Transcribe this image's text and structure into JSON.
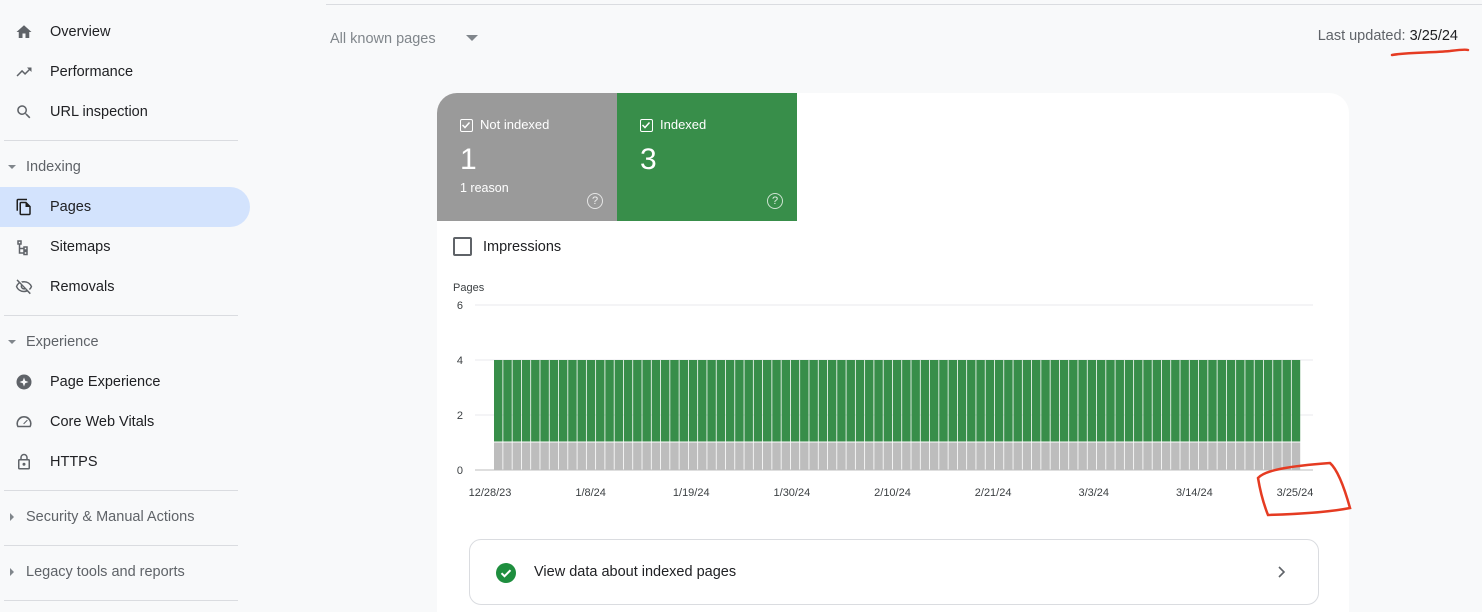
{
  "sidebar": {
    "items": [
      {
        "label": "Overview",
        "icon": "home-icon"
      },
      {
        "label": "Performance",
        "icon": "trending-up-icon"
      },
      {
        "label": "URL inspection",
        "icon": "search-icon"
      }
    ],
    "indexing": {
      "label": "Indexing",
      "items": [
        {
          "label": "Pages",
          "icon": "pages-icon",
          "active": true
        },
        {
          "label": "Sitemaps",
          "icon": "sitemap-icon"
        },
        {
          "label": "Removals",
          "icon": "eye-off-icon"
        }
      ]
    },
    "experience": {
      "label": "Experience",
      "items": [
        {
          "label": "Page Experience",
          "icon": "page-experience-icon"
        },
        {
          "label": "Core Web Vitals",
          "icon": "speedometer-icon"
        },
        {
          "label": "HTTPS",
          "icon": "lock-icon"
        }
      ]
    },
    "security": {
      "label": "Security & Manual Actions"
    },
    "legacy": {
      "label": "Legacy tools and reports"
    }
  },
  "header": {
    "filter_label": "All known pages",
    "updated_label": "Last updated: ",
    "updated_value": "3/25/24"
  },
  "tiles": {
    "not_indexed": {
      "label": "Not indexed",
      "value": "1",
      "sub": "1 reason",
      "color": "#9a9a9a"
    },
    "indexed": {
      "label": "Indexed",
      "value": "3",
      "color": "#388e4a"
    }
  },
  "impressions_label": "Impressions",
  "view_row": {
    "label": "View data about indexed pages"
  },
  "colors": {
    "indexed": "#388e4a",
    "not_indexed": "#bdbdbd",
    "annotation": "#e53b22",
    "active_nav": "#d3e3fd"
  },
  "chart_data": {
    "type": "bar",
    "stacked": true,
    "ylabel": "Pages",
    "ylim": [
      0,
      6
    ],
    "yticks": [
      0,
      2,
      4,
      6
    ],
    "xtick_labels": [
      "12/28/23",
      "1/8/24",
      "1/19/24",
      "1/30/24",
      "2/10/24",
      "2/21/24",
      "3/3/24",
      "3/14/24",
      "3/25/24"
    ],
    "x_start": "12/30/23",
    "x_end": "3/25/24",
    "bar_count": 87,
    "series": [
      {
        "name": "Not indexed",
        "value_each_day": 1,
        "color": "#bdbdbd"
      },
      {
        "name": "Indexed",
        "value_each_day": 3,
        "color": "#388e4a"
      }
    ]
  }
}
